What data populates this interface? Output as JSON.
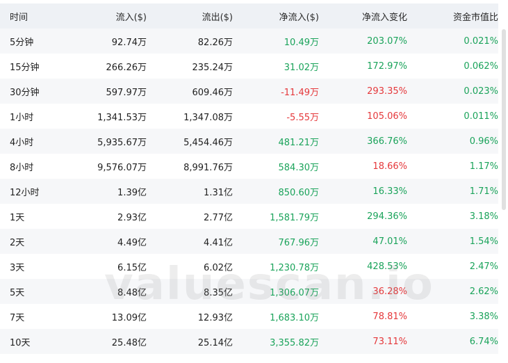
{
  "columns": [
    "时间",
    "流入($)",
    "流出($)",
    "净流入($)",
    "净流入变化",
    "资金市值比"
  ],
  "rows": [
    {
      "period": "5分钟",
      "inflow": "92.74万",
      "outflow": "82.26万",
      "net": "10.49万",
      "net_sign": "pos",
      "change": "203.07%",
      "change_sign": "pos",
      "ratio": "0.021%"
    },
    {
      "period": "15分钟",
      "inflow": "266.26万",
      "outflow": "235.24万",
      "net": "31.02万",
      "net_sign": "pos",
      "change": "172.97%",
      "change_sign": "pos",
      "ratio": "0.062%"
    },
    {
      "period": "30分钟",
      "inflow": "597.97万",
      "outflow": "609.46万",
      "net": "-11.49万",
      "net_sign": "neg",
      "change": "293.35%",
      "change_sign": "neg",
      "ratio": "0.023%"
    },
    {
      "period": "1小时",
      "inflow": "1,341.53万",
      "outflow": "1,347.08万",
      "net": "-5.55万",
      "net_sign": "neg",
      "change": "105.06%",
      "change_sign": "neg",
      "ratio": "0.011%"
    },
    {
      "period": "4小时",
      "inflow": "5,935.67万",
      "outflow": "5,454.46万",
      "net": "481.21万",
      "net_sign": "pos",
      "change": "366.76%",
      "change_sign": "pos",
      "ratio": "0.96%"
    },
    {
      "period": "8小时",
      "inflow": "9,576.07万",
      "outflow": "8,991.76万",
      "net": "584.30万",
      "net_sign": "pos",
      "change": "18.66%",
      "change_sign": "neg",
      "ratio": "1.17%"
    },
    {
      "period": "12小时",
      "inflow": "1.39亿",
      "outflow": "1.31亿",
      "net": "850.60万",
      "net_sign": "pos",
      "change": "16.33%",
      "change_sign": "pos",
      "ratio": "1.71%"
    },
    {
      "period": "1天",
      "inflow": "2.93亿",
      "outflow": "2.77亿",
      "net": "1,581.79万",
      "net_sign": "pos",
      "change": "294.36%",
      "change_sign": "pos",
      "ratio": "3.18%"
    },
    {
      "period": "2天",
      "inflow": "4.49亿",
      "outflow": "4.41亿",
      "net": "767.96万",
      "net_sign": "pos",
      "change": "47.01%",
      "change_sign": "pos",
      "ratio": "1.54%"
    },
    {
      "period": "3天",
      "inflow": "6.15亿",
      "outflow": "6.02亿",
      "net": "1,230.78万",
      "net_sign": "pos",
      "change": "428.53%",
      "change_sign": "pos",
      "ratio": "2.47%"
    },
    {
      "period": "5天",
      "inflow": "8.48亿",
      "outflow": "8.35亿",
      "net": "1,306.07万",
      "net_sign": "pos",
      "change": "36.28%",
      "change_sign": "neg",
      "ratio": "2.62%"
    },
    {
      "period": "7天",
      "inflow": "13.09亿",
      "outflow": "12.93亿",
      "net": "1,683.10万",
      "net_sign": "pos",
      "change": "78.81%",
      "change_sign": "neg",
      "ratio": "3.38%"
    },
    {
      "period": "10天",
      "inflow": "25.48亿",
      "outflow": "25.14亿",
      "net": "3,355.82万",
      "net_sign": "pos",
      "change": "73.11%",
      "change_sign": "neg",
      "ratio": "6.74%"
    }
  ],
  "watermark": "valuescan.io",
  "colors": {
    "positive": "#1aa35a",
    "negative": "#e5383b",
    "header_bg": "#eef1f5",
    "stripe_bg": "#f6f7f9"
  }
}
